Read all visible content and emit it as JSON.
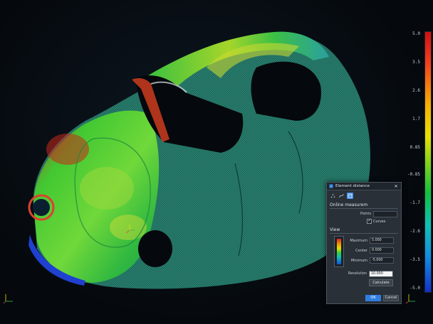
{
  "scale": {
    "ticks": [
      "5.0",
      "3.5",
      "2.6",
      "1.7",
      "0.85",
      "-0.85",
      "-1.7",
      "-2.6",
      "-3.5",
      "-5.0"
    ]
  },
  "dialog": {
    "title": "Element distance",
    "close_label": "✕",
    "toolbar": [
      "points-tool",
      "curve-tool",
      "surface-tool"
    ],
    "online_section": "Online measurem",
    "points_label": "Points",
    "points_value": "",
    "curves_label": "Curves",
    "curves_checked": "✓",
    "view_section": "View",
    "maximum_label": "Maximum",
    "maximum_value": "5.000",
    "center_label": "Center",
    "center_value": "0.000",
    "minimum_label": "Minimum",
    "minimum_value": "-5.000",
    "resolution_label": "Resolution",
    "resolution_value": "10.000",
    "calculate_label": "Calculate",
    "ok_label": "OK",
    "cancel_label": "Cancel"
  },
  "colors": {
    "scale_top": "#d01010",
    "scale_bottom": "#1030d0",
    "accent": "#2f7ee0"
  }
}
